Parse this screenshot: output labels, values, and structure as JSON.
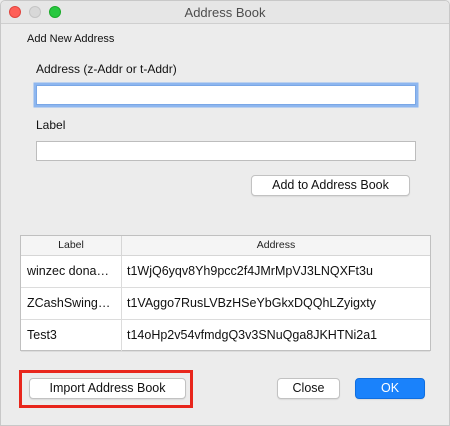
{
  "window": {
    "title": "Address Book"
  },
  "group": {
    "title": "Add New Address"
  },
  "form": {
    "address_label": "Address (z-Addr or t-Addr)",
    "address_value": "",
    "label_label": "Label",
    "label_value": "",
    "add_button": "Add to Address Book"
  },
  "table": {
    "headers": [
      "Label",
      "Address"
    ],
    "rows": [
      {
        "label": "winzec dona…",
        "address": "t1WjQ6yqv8Yh9pcc2f4JMrMpVJ3LNQXFt3u"
      },
      {
        "label": "ZCashSwing…",
        "address": "t1VAggo7RusLVBzHSeYbGkxDQQhLZyigxty"
      },
      {
        "label": "Test3",
        "address": "t14oHp2v54vfmdgQ3v3SNuQga8JKHTNi2a1"
      }
    ]
  },
  "buttons": {
    "import": "Import Address Book",
    "close": "Close",
    "ok": "OK"
  },
  "colors": {
    "accent": "#1a82fb",
    "highlight_border": "#e8261c",
    "focus_ring": "#8db6ef"
  }
}
